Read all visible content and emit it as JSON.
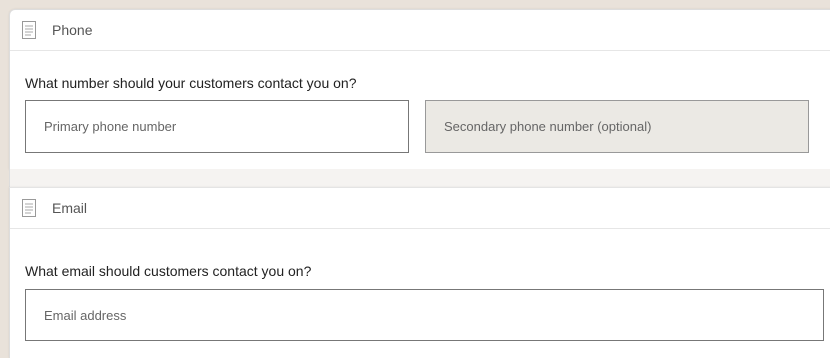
{
  "phone": {
    "title": "Phone",
    "question": "What number should your customers contact you on?",
    "primary_placeholder": "Primary phone number",
    "secondary_placeholder": "Secondary phone number (optional)"
  },
  "email": {
    "title": "Email",
    "question": "What email should customers contact you on?",
    "address_placeholder": "Email address"
  },
  "icons": {
    "section_icon": "document-icon"
  }
}
